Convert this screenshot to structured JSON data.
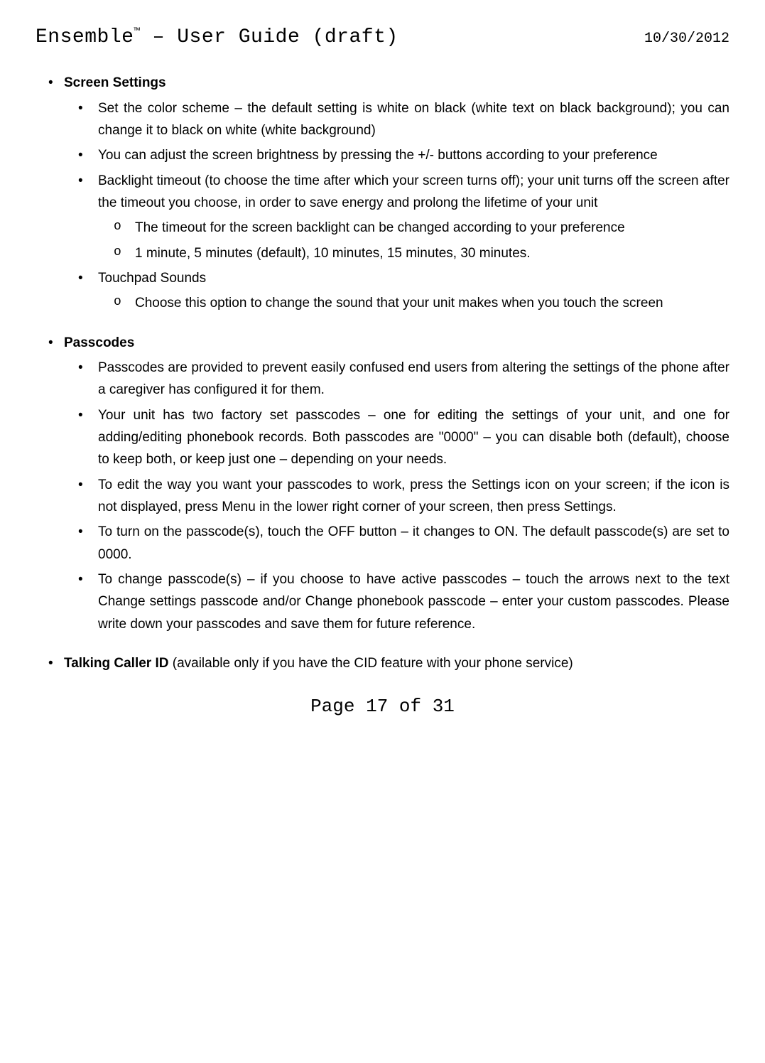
{
  "header": {
    "title_prefix": "Ensemble",
    "title_tm": "™",
    "title_suffix": " – User Guide (draft)",
    "date": "10/30/2012"
  },
  "sections": {
    "screen_settings": {
      "heading": "Screen Settings",
      "items": [
        "Set the color scheme – the default setting is white on black (white text on black background); you can change it to black on white (white background)",
        "You can adjust the screen brightness by pressing the +/- buttons according to your preference",
        "Backlight timeout (to choose the time after which your screen turns off); your unit turns off the screen after the timeout you choose, in order to save energy and prolong the lifetime of your unit",
        "Touchpad Sounds"
      ],
      "backlight_sub": [
        "The timeout for the screen backlight can be changed according to your preference",
        "1 minute, 5 minutes (default), 10 minutes, 15 minutes, 30 minutes."
      ],
      "touchpad_sub": [
        "Choose this option to change the sound that your unit makes when you touch the screen"
      ]
    },
    "passcodes": {
      "heading": "Passcodes",
      "items": [
        "Passcodes are provided to prevent easily confused end users from altering the settings of the phone after a caregiver has configured it for them.",
        "Your unit has two factory set passcodes – one for editing the settings of your unit, and one for adding/editing phonebook records. Both passcodes are \"0000\" – you can disable both (default), choose to keep both, or keep just one – depending on your needs.",
        "To edit the way you want your passcodes to work, press the Settings icon on your screen; if the icon is not displayed, press Menu in the lower right corner of your screen, then press Settings.",
        "To turn on the passcode(s), touch the OFF button – it changes to ON. The default passcode(s) are set to 0000.",
        "To change passcode(s) – if you choose to have active passcodes – touch the arrows next to the text Change settings passcode and/or Change phonebook passcode – enter your custom passcodes. Please write down your passcodes and save them for future reference."
      ]
    },
    "talking_cid": {
      "heading": "Talking Caller ID",
      "note": " (available only if you have the CID feature with your phone service)"
    }
  },
  "footer": "Page 17 of 31"
}
